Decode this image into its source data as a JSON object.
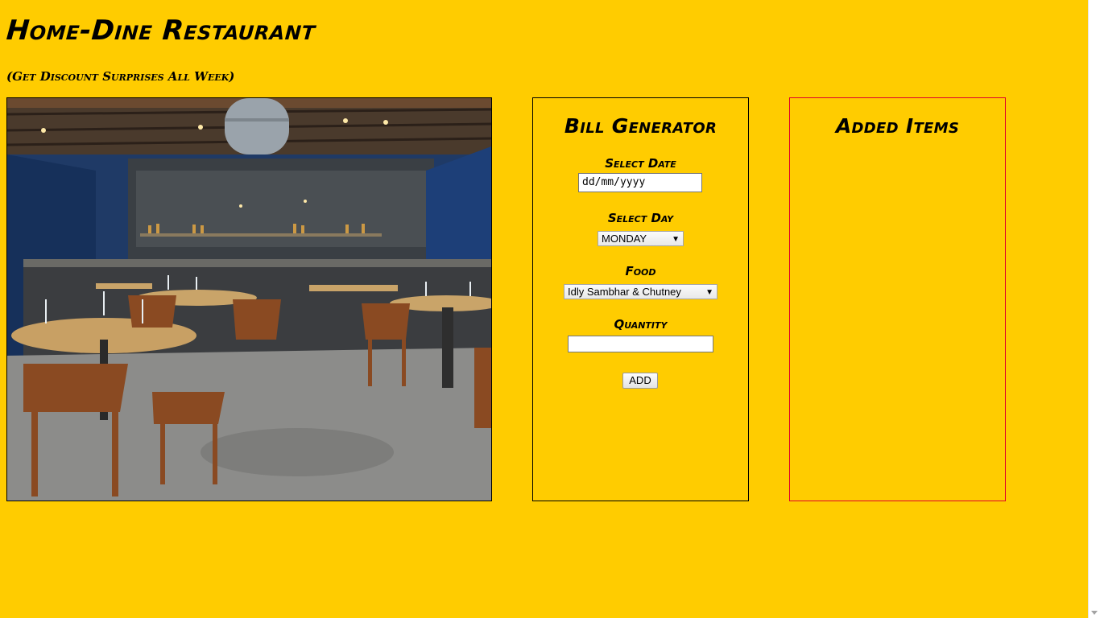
{
  "header": {
    "title": "Home-Dine Restaurant",
    "subtitle": "(Get Discount Surprises All Week)"
  },
  "bill": {
    "heading": "Bill Generator",
    "date_label": "Select Date",
    "date_placeholder": "dd/mm/yyyy",
    "day_label": "Select Day",
    "day_value": "MONDAY",
    "food_label": "Food",
    "food_value": "Idly Sambhar & Chutney",
    "quantity_label": "Quantity",
    "quantity_value": "",
    "add_label": "ADD"
  },
  "items": {
    "heading": "Added Items"
  },
  "colors": {
    "background": "#ffcc00",
    "items_border": "#e0002a"
  }
}
